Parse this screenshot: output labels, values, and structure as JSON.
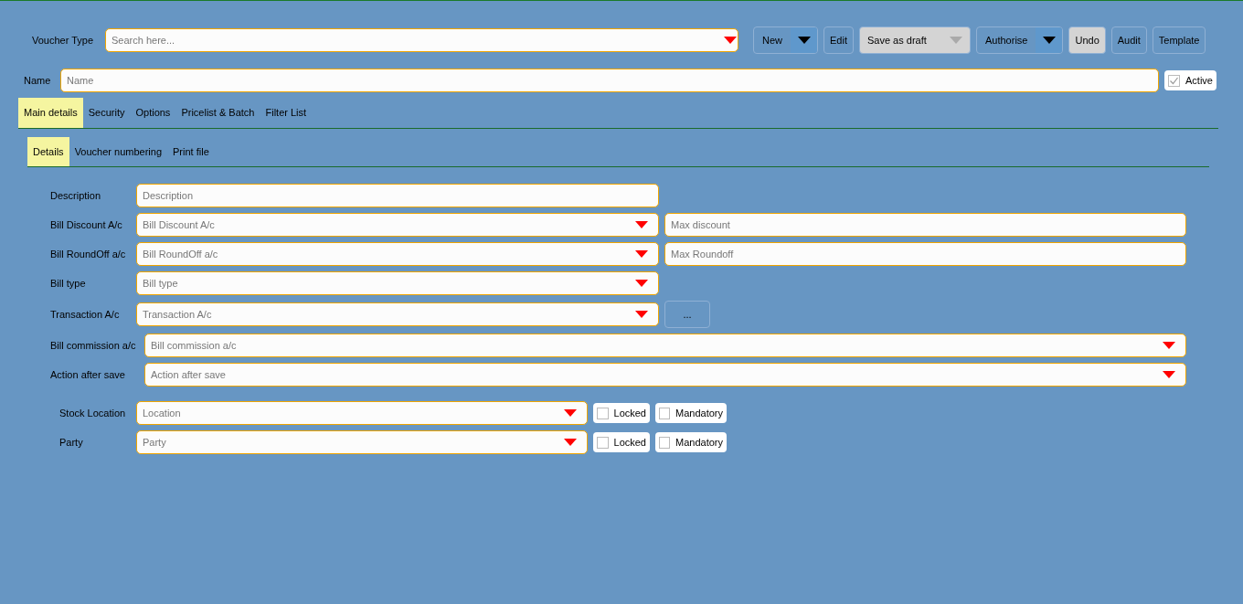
{
  "voucher_type": {
    "label": "Voucher Type",
    "placeholder": "Search here..."
  },
  "buttons": [
    {
      "label": "New",
      "kind": "split"
    },
    {
      "label": "Edit",
      "kind": "plain"
    },
    {
      "label": "Save as draft",
      "kind": "grey-dropdown"
    },
    {
      "label": "Authorise",
      "kind": "split"
    },
    {
      "label": "Undo",
      "kind": "grey"
    },
    {
      "label": "Audit",
      "kind": "plain"
    },
    {
      "label": "Template",
      "kind": "plain"
    }
  ],
  "name": {
    "label": "Name",
    "placeholder": "Name"
  },
  "active": {
    "label": "Active",
    "checked": true
  },
  "tabs": [
    {
      "label": "Main details",
      "selected": true
    },
    {
      "label": "Security",
      "selected": false
    },
    {
      "label": "Options",
      "selected": false
    },
    {
      "label": "Pricelist & Batch",
      "selected": false
    },
    {
      "label": "Filter List",
      "selected": false
    }
  ],
  "subtabs": [
    {
      "label": "Details",
      "selected": true
    },
    {
      "label": "Voucher numbering",
      "selected": false
    },
    {
      "label": "Print file",
      "selected": false
    }
  ],
  "fields": [
    {
      "label": "Description",
      "kind": "text",
      "placeholder": "Description"
    },
    {
      "label": "Bill Discount A/c",
      "kind": "dropdown",
      "placeholder": "Bill Discount A/c",
      "side_placeholder": "Max discount"
    },
    {
      "label": "Bill RoundOff a/c",
      "kind": "dropdown",
      "placeholder": "Bill RoundOff a/c",
      "side_placeholder": "Max Roundoff"
    },
    {
      "label": "Bill type",
      "kind": "dropdown",
      "placeholder": "Bill type"
    },
    {
      "label": "Transaction A/c",
      "kind": "dropdown",
      "placeholder": "Transaction A/c",
      "side_button": "..."
    },
    {
      "label": "Bill commission a/c",
      "kind": "wide",
      "placeholder": "Bill commission a/c"
    },
    {
      "label": "Action after save",
      "kind": "wide",
      "placeholder": "Action after save"
    }
  ],
  "stock_rows": [
    {
      "label": "Stock Location",
      "placeholder": "Location",
      "locked": {
        "label": "Locked",
        "checked": false
      },
      "mandatory": {
        "label": "Mandatory",
        "checked": false
      }
    },
    {
      "label": "Party",
      "placeholder": "Party",
      "locked": {
        "label": "Locked",
        "checked": false
      },
      "mandatory": {
        "label": "Mandatory",
        "checked": false
      }
    }
  ]
}
